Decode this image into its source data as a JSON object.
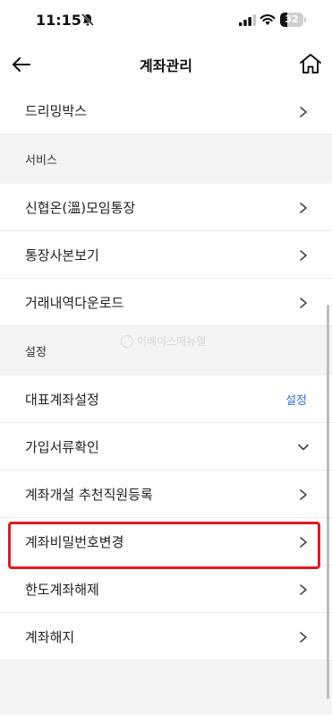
{
  "status_bar": {
    "time": "11:15",
    "battery": "32",
    "battery_level": 0.32
  },
  "header": {
    "title": "계좌관리",
    "back_icon": "arrow-left-icon",
    "home_icon": "home-icon"
  },
  "watermark": "이베이스매뉴얼",
  "top_item": {
    "label": "드리밍박스"
  },
  "sections": [
    {
      "title": "서비스",
      "items": [
        {
          "label": "신협온(溫)모임통장"
        },
        {
          "label": "통장사본보기"
        },
        {
          "label": "거래내역다운로드"
        }
      ]
    },
    {
      "title": "설정",
      "items": [
        {
          "label": "대표계좌설정",
          "action": "설정"
        },
        {
          "label": "가입서류확인"
        },
        {
          "label": "계좌개설 추천직원등록"
        },
        {
          "label": "계좌비밀번호변경"
        },
        {
          "label": "한도계좌해제"
        },
        {
          "label": "계좌해지"
        }
      ]
    }
  ]
}
